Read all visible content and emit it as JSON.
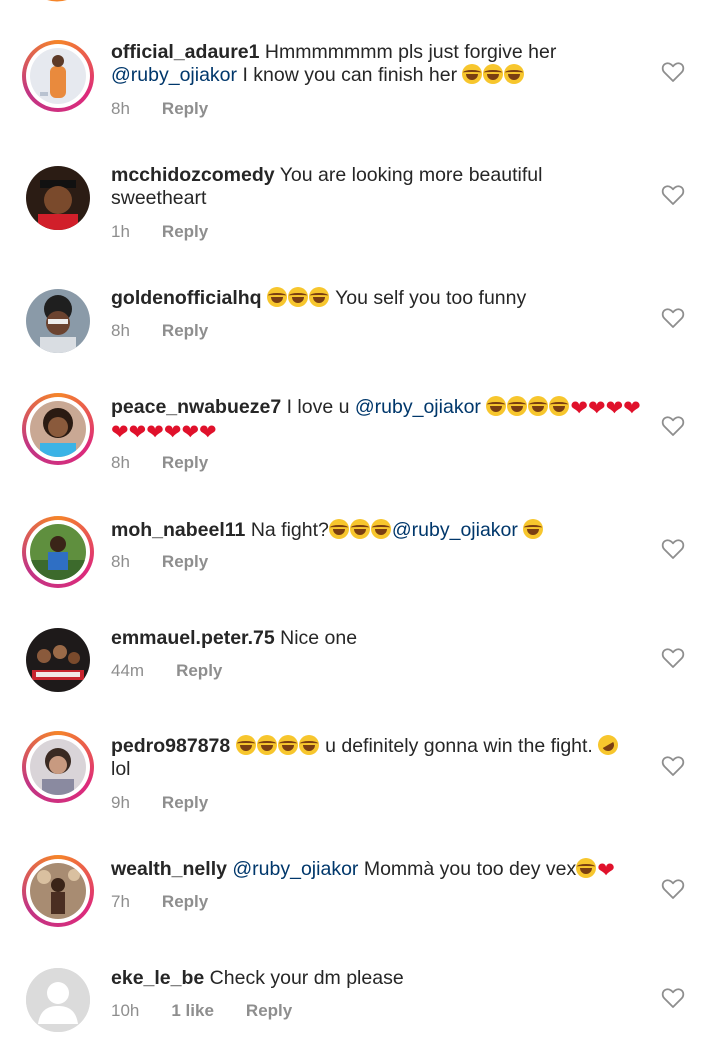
{
  "comments": [
    {
      "username": "official_adaure1",
      "parts": [
        {
          "t": "text",
          "v": " Hmmmmmmm pls just forgive her "
        },
        {
          "t": "mention",
          "v": "@ruby_ojiakor"
        },
        {
          "t": "text",
          "v": " I know you can finish her "
        },
        {
          "t": "laugh"
        },
        {
          "t": "laugh"
        },
        {
          "t": "laugh"
        }
      ],
      "time": "8h",
      "likes": "",
      "reply": "Reply",
      "avatar": "official-adaure1-avatar",
      "ring": true
    },
    {
      "username": "mcchidozcomedy",
      "parts": [
        {
          "t": "text",
          "v": " You are looking more beautiful sweetheart"
        }
      ],
      "time": "1h",
      "likes": "",
      "reply": "Reply",
      "avatar": "mcchidozcomedy-avatar",
      "ring": false
    },
    {
      "username": "goldenofficialhq",
      "parts": [
        {
          "t": "text",
          "v": " "
        },
        {
          "t": "laugh"
        },
        {
          "t": "laugh"
        },
        {
          "t": "laugh"
        },
        {
          "t": "text",
          "v": " You self you too funny"
        }
      ],
      "time": "8h",
      "likes": "",
      "reply": "Reply",
      "avatar": "goldenofficialhq-avatar",
      "ring": false
    },
    {
      "username": "peace_nwabueze7",
      "parts": [
        {
          "t": "text",
          "v": " I love u "
        },
        {
          "t": "mention",
          "v": "@ruby_ojiakor"
        },
        {
          "t": "text",
          "v": " "
        },
        {
          "t": "laugh"
        },
        {
          "t": "laugh"
        },
        {
          "t": "laugh"
        },
        {
          "t": "laugh"
        },
        {
          "t": "heart"
        },
        {
          "t": "heart"
        },
        {
          "t": "heart"
        },
        {
          "t": "heart"
        },
        {
          "t": "heart"
        },
        {
          "t": "heart"
        },
        {
          "t": "heart"
        },
        {
          "t": "heart"
        },
        {
          "t": "heart"
        },
        {
          "t": "heart"
        }
      ],
      "time": "8h",
      "likes": "",
      "reply": "Reply",
      "avatar": "peace-nwabueze7-avatar",
      "ring": true
    },
    {
      "username": "moh_nabeel11",
      "parts": [
        {
          "t": "text",
          "v": " Na fight?"
        },
        {
          "t": "laugh"
        },
        {
          "t": "laugh"
        },
        {
          "t": "laugh"
        },
        {
          "t": "mention",
          "v": "@ruby_ojiakor"
        },
        {
          "t": "text",
          "v": " "
        },
        {
          "t": "laugh"
        }
      ],
      "time": "8h",
      "likes": "",
      "reply": "Reply",
      "avatar": "moh-nabeel11-avatar",
      "ring": true
    },
    {
      "username": "emmauel.peter.75",
      "parts": [
        {
          "t": "text",
          "v": " Nice one"
        }
      ],
      "time": "44m",
      "likes": "",
      "reply": "Reply",
      "avatar": "emmauel-peter-75-avatar",
      "ring": false
    },
    {
      "username": "pedro987878",
      "parts": [
        {
          "t": "text",
          "v": " "
        },
        {
          "t": "laugh"
        },
        {
          "t": "laugh"
        },
        {
          "t": "laugh"
        },
        {
          "t": "laugh"
        },
        {
          "t": "text",
          "v": " u definitely gonna win the fight. "
        },
        {
          "t": "rofl"
        },
        {
          "t": "text",
          "v": " lol"
        }
      ],
      "time": "9h",
      "likes": "",
      "reply": "Reply",
      "avatar": "pedro987878-avatar",
      "ring": true
    },
    {
      "username": "wealth_nelly",
      "parts": [
        {
          "t": "text",
          "v": " "
        },
        {
          "t": "mention",
          "v": "@ruby_ojiakor"
        },
        {
          "t": "text",
          "v": " Mommà you too dey vex"
        },
        {
          "t": "laugh"
        },
        {
          "t": "heart"
        }
      ],
      "time": "7h",
      "likes": "",
      "reply": "Reply",
      "avatar": "wealth-nelly-avatar",
      "ring": true
    },
    {
      "username": "eke_le_be",
      "parts": [
        {
          "t": "text",
          "v": " Check your dm please"
        }
      ],
      "time": "10h",
      "likes": "1 like",
      "reply": "Reply",
      "avatar": "eke-le-be-avatar",
      "ring": false
    }
  ],
  "colors": {
    "text": "#262626",
    "mention": "#00376b",
    "meta": "#8e8e8e",
    "ring_start": "#f58529",
    "ring_mid": "#dd2a7b"
  },
  "icons": {
    "like": "heart-outline-icon"
  }
}
